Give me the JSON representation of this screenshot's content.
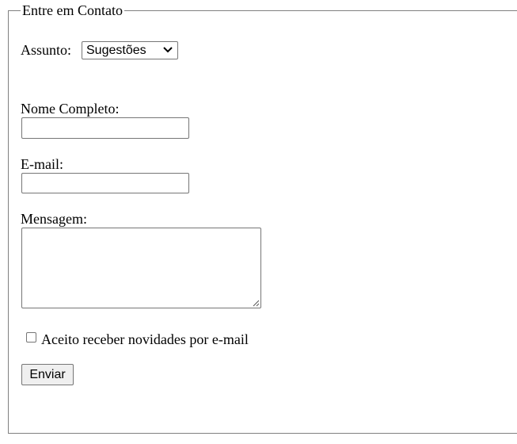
{
  "form": {
    "legend": "Entre em Contato",
    "subject": {
      "label": "Assunto:",
      "selected": "Sugestões",
      "icon": "chevron-down-icon"
    },
    "name": {
      "label": "Nome Completo:",
      "value": ""
    },
    "email": {
      "label": "E-mail:",
      "value": ""
    },
    "message": {
      "label": "Mensagem:",
      "value": ""
    },
    "newsletter": {
      "label": "Aceito receber novidades por e-mail",
      "checked": false
    },
    "submit_label": "Enviar"
  },
  "colors": {
    "border": "#767676",
    "fieldset_border": "#808080",
    "button_bg": "#efefef"
  }
}
